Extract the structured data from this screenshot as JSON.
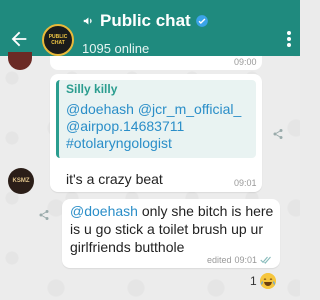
{
  "header": {
    "title": "Public chat",
    "subtitle": "1095 online",
    "avatar_text": "PUBLIC CHAT",
    "icons": [
      "back-arrow-icon",
      "megaphone-icon",
      "verified-icon",
      "menu-dots-icon"
    ],
    "color": "#1f8a7e"
  },
  "messages": [
    {
      "time": "09:00"
    },
    {
      "sender_avatar_text": "KSMZ",
      "reply": {
        "name": "Silly killy",
        "text": "@doehash @jcr_m_official_ @airpop.14683711 #otolaryngologist"
      },
      "text": "it's a crazy beat",
      "time": "09:01"
    },
    {
      "mention": "@doehash",
      "text": " only she bitch is here is u go stick a toilet brush up ur girlfriends butthole",
      "status": "edited",
      "time": "09:01"
    }
  ],
  "reaction": {
    "count": "1",
    "emoji": "😂"
  },
  "colors": {
    "accent": "#2a9d8f",
    "link": "#2a8ec8"
  }
}
